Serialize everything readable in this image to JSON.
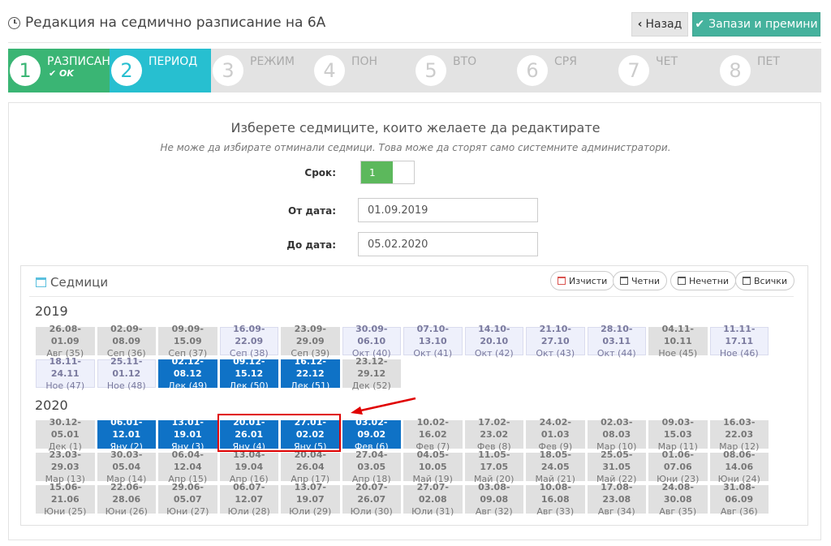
{
  "header": {
    "title": "Редакция на седмично разписание на 6А",
    "back_label": "Назад",
    "save_label": "Запази и премини"
  },
  "steps": [
    {
      "num": "1",
      "label": "РАЗПИСАН",
      "sub": "OK",
      "state": "done"
    },
    {
      "num": "2",
      "label": "ПЕРИОД",
      "sub": "",
      "state": "active"
    },
    {
      "num": "3",
      "label": "РЕЖИМ",
      "sub": "",
      "state": "pending"
    },
    {
      "num": "4",
      "label": "ПОН",
      "sub": "",
      "state": "pending"
    },
    {
      "num": "5",
      "label": "ВТО",
      "sub": "",
      "state": "pending"
    },
    {
      "num": "6",
      "label": "СРЯ",
      "sub": "",
      "state": "pending"
    },
    {
      "num": "7",
      "label": "ЧЕТ",
      "sub": "",
      "state": "pending"
    },
    {
      "num": "8",
      "label": "ПЕТ",
      "sub": "",
      "state": "pending"
    }
  ],
  "form": {
    "heading": "Изберете седмиците, които желаете да редактирате",
    "subheading": "Не може да избирате отминали седмици. Това може да сторят само системните администратори.",
    "term_label": "Срок:",
    "term_value": "1",
    "from_label": "От дата:",
    "from_value": "01.09.2019",
    "to_label": "До дата:",
    "to_value": "05.02.2020"
  },
  "weeks_panel": {
    "title": "Седмици",
    "clear_label": "Изчисти",
    "even_label": "Четни",
    "odd_label": "Нечетни",
    "all_label": "Всички"
  },
  "years": [
    {
      "year": "2019",
      "weeks": [
        {
          "range": "26.08-01.09",
          "month": "Авг (35)",
          "state": "past"
        },
        {
          "range": "02.09-08.09",
          "month": "Сеп (36)",
          "state": "past"
        },
        {
          "range": "09.09-15.09",
          "month": "Сеп (37)",
          "state": "past"
        },
        {
          "range": "16.09-22.09",
          "month": "Сеп (38)",
          "state": "free"
        },
        {
          "range": "23.09-29.09",
          "month": "Сеп (39)",
          "state": "past"
        },
        {
          "range": "30.09-06.10",
          "month": "Окт (40)",
          "state": "free"
        },
        {
          "range": "07.10-13.10",
          "month": "Окт (41)",
          "state": "free"
        },
        {
          "range": "14.10-20.10",
          "month": "Окт (42)",
          "state": "free"
        },
        {
          "range": "21.10-27.10",
          "month": "Окт (43)",
          "state": "free"
        },
        {
          "range": "28.10-03.11",
          "month": "Окт (44)",
          "state": "free"
        },
        {
          "range": "04.11-10.11",
          "month": "Ное (45)",
          "state": "past"
        },
        {
          "range": "11.11-17.11",
          "month": "Ное (46)",
          "state": "free"
        },
        {
          "range": "18.11-24.11",
          "month": "Ное (47)",
          "state": "free"
        },
        {
          "range": "25.11-01.12",
          "month": "Ное (48)",
          "state": "free"
        },
        {
          "range": "02.12-08.12",
          "month": "Дек (49)",
          "state": "sel"
        },
        {
          "range": "09.12-15.12",
          "month": "Дек (50)",
          "state": "sel"
        },
        {
          "range": "16.12-22.12",
          "month": "Дек (51)",
          "state": "sel"
        },
        {
          "range": "23.12-29.12",
          "month": "Дек (52)",
          "state": "past"
        }
      ]
    },
    {
      "year": "2020",
      "weeks": [
        {
          "range": "30.12-05.01",
          "month": "Дек (1)",
          "state": "past"
        },
        {
          "range": "06.01-12.01",
          "month": "Яну (2)",
          "state": "sel"
        },
        {
          "range": "13.01-19.01",
          "month": "Яну (3)",
          "state": "sel"
        },
        {
          "range": "20.01-26.01",
          "month": "Яну (4)",
          "state": "sel"
        },
        {
          "range": "27.01-02.02",
          "month": "Яну (5)",
          "state": "sel"
        },
        {
          "range": "03.02-09.02",
          "month": "Фев (6)",
          "state": "sel"
        },
        {
          "range": "10.02-16.02",
          "month": "Фев (7)",
          "state": "past"
        },
        {
          "range": "17.02-23.02",
          "month": "Фев (8)",
          "state": "past"
        },
        {
          "range": "24.02-01.03",
          "month": "Фев (9)",
          "state": "past"
        },
        {
          "range": "02.03-08.03",
          "month": "Мар (10)",
          "state": "past"
        },
        {
          "range": "09.03-15.03",
          "month": "Мар (11)",
          "state": "past"
        },
        {
          "range": "16.03-22.03",
          "month": "Мар (12)",
          "state": "past"
        },
        {
          "range": "23.03-29.03",
          "month": "Мар (13)",
          "state": "past"
        },
        {
          "range": "30.03-05.04",
          "month": "Мар (14)",
          "state": "past"
        },
        {
          "range": "06.04-12.04",
          "month": "Апр (15)",
          "state": "past"
        },
        {
          "range": "13.04-19.04",
          "month": "Апр (16)",
          "state": "past"
        },
        {
          "range": "20.04-26.04",
          "month": "Апр (17)",
          "state": "past"
        },
        {
          "range": "27.04-03.05",
          "month": "Апр (18)",
          "state": "past"
        },
        {
          "range": "04.05-10.05",
          "month": "Май (19)",
          "state": "past"
        },
        {
          "range": "11.05-17.05",
          "month": "Май (20)",
          "state": "past"
        },
        {
          "range": "18.05-24.05",
          "month": "Май (21)",
          "state": "past"
        },
        {
          "range": "25.05-31.05",
          "month": "Май (22)",
          "state": "past"
        },
        {
          "range": "01.06-07.06",
          "month": "Юни (23)",
          "state": "past"
        },
        {
          "range": "08.06-14.06",
          "month": "Юни (24)",
          "state": "past"
        },
        {
          "range": "15.06-21.06",
          "month": "Юни (25)",
          "state": "past"
        },
        {
          "range": "22.06-28.06",
          "month": "Юни (26)",
          "state": "past"
        },
        {
          "range": "29.06-05.07",
          "month": "Юни (27)",
          "state": "past"
        },
        {
          "range": "06.07-12.07",
          "month": "Юли (28)",
          "state": "past"
        },
        {
          "range": "13.07-19.07",
          "month": "Юли (29)",
          "state": "past"
        },
        {
          "range": "20.07-26.07",
          "month": "Юли (30)",
          "state": "past"
        },
        {
          "range": "27.07-02.08",
          "month": "Юли (31)",
          "state": "past"
        },
        {
          "range": "03.08-09.08",
          "month": "Авг (32)",
          "state": "past"
        },
        {
          "range": "10.08-16.08",
          "month": "Авг (33)",
          "state": "past"
        },
        {
          "range": "17.08-23.08",
          "month": "Авг (34)",
          "state": "past"
        },
        {
          "range": "24.08-30.08",
          "month": "Авг (35)",
          "state": "past"
        },
        {
          "range": "31.08-06.09",
          "month": "Авг (36)",
          "state": "past"
        }
      ]
    }
  ]
}
